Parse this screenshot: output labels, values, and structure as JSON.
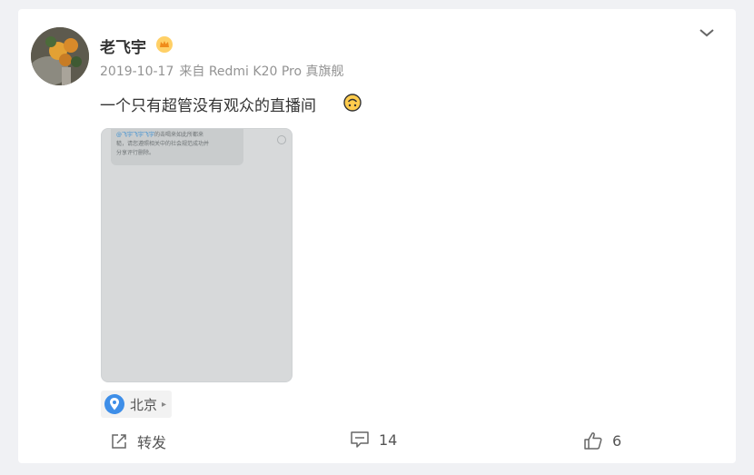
{
  "post": {
    "username": "老飞宇",
    "date": "2019-10-17",
    "source": "来自 Redmi K20 Pro 真旗舰",
    "text": "一个只有超管没有观众的直播间",
    "emoji_icon": "upside-down-face-icon",
    "vip_icon": "vip-crown-icon"
  },
  "image": {
    "bubble_link": "@飞宇飞宇飞宇",
    "bubble_text": "的击喝来如此所都来\n糙，请您遵照相关中的社会规范成功并\n分享评行删除。"
  },
  "location": {
    "label": "北京",
    "icon": "location-pin-icon"
  },
  "actions": {
    "repost_label": "转发",
    "comment_count": "14",
    "like_count": "6"
  },
  "colors": {
    "accent_blue": "#3d8fd1",
    "card_bg": "#ffffff",
    "page_bg": "#f0f1f4"
  }
}
